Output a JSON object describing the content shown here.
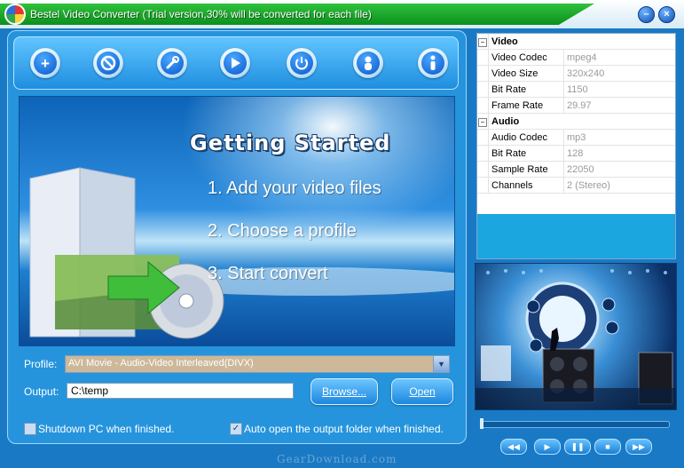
{
  "window": {
    "title": "Bestel Video Converter  (Trial version,30% will be converted for each file)",
    "minimize_icon": "minimize-icon",
    "close_icon": "close-icon"
  },
  "toolbar": {
    "buttons": [
      {
        "name": "add-file-button",
        "icon": "plus-icon",
        "glyph": "+"
      },
      {
        "name": "remove-button",
        "icon": "prohibit-icon",
        "glyph": "⃠"
      },
      {
        "name": "settings-button",
        "icon": "wrench-icon",
        "glyph": "🔧"
      },
      {
        "name": "convert-button",
        "icon": "play-icon",
        "glyph": "▶"
      },
      {
        "name": "power-button",
        "icon": "power-icon",
        "glyph": "⏻"
      },
      {
        "name": "user-button",
        "icon": "person-icon",
        "glyph": "👤"
      },
      {
        "name": "info-button",
        "icon": "info-icon",
        "glyph": "ℹ"
      }
    ]
  },
  "banner": {
    "title": "Getting Started",
    "steps": [
      "1. Add your video files",
      "2. Choose a profile",
      "3. Start convert"
    ]
  },
  "form": {
    "profile_label": "Profile:",
    "profile_value": "AVI Movie - Audio-Video Interleaved(DIVX)",
    "output_label": "Output:",
    "output_value": "C:\\temp",
    "browse_label": "Browse...",
    "open_label": "Open",
    "shutdown_label": "Shutdown PC when finished.",
    "shutdown_checked": false,
    "autoopen_label": "Auto open the output folder when finished.",
    "autoopen_checked": true
  },
  "properties": {
    "video": {
      "category": "Video",
      "rows": [
        {
          "key": "Video Codec",
          "value": "mpeg4"
        },
        {
          "key": "Video Size",
          "value": "320x240"
        },
        {
          "key": "Bit Rate",
          "value": "1150"
        },
        {
          "key": "Frame Rate",
          "value": "29.97"
        }
      ]
    },
    "audio": {
      "category": "Audio",
      "rows": [
        {
          "key": "Audio Codec",
          "value": "mp3"
        },
        {
          "key": "Bit Rate",
          "value": "128"
        },
        {
          "key": "Sample Rate",
          "value": "22050"
        },
        {
          "key": "Channels",
          "value": "2 (Stereo)"
        }
      ]
    }
  },
  "player": {
    "seek_position": 0.0,
    "controls": [
      {
        "name": "rewind-button",
        "icon": "rewind-icon",
        "glyph": "◀◀"
      },
      {
        "name": "play-button",
        "icon": "play-icon",
        "glyph": "▶"
      },
      {
        "name": "pause-button",
        "icon": "pause-icon",
        "glyph": "❚❚"
      },
      {
        "name": "stop-button",
        "icon": "stop-icon",
        "glyph": "■"
      },
      {
        "name": "forward-button",
        "icon": "fast-forward-icon",
        "glyph": "▶▶"
      }
    ]
  },
  "watermark": "GearDownload.com",
  "colors": {
    "accent": "#1a79c4",
    "title_band": "#22b030",
    "profile_field": "#cdb89a"
  }
}
